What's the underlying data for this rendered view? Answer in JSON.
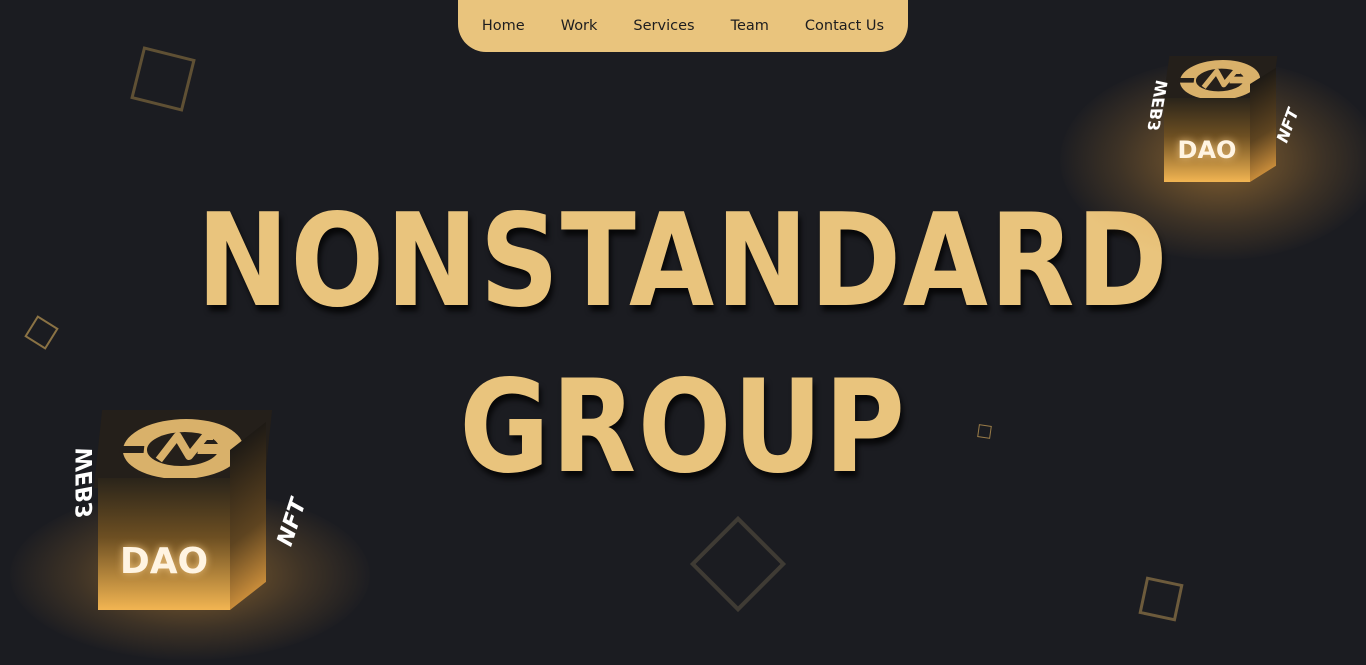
{
  "nav": {
    "items": [
      "Home",
      "Work",
      "Services",
      "Team",
      "Contact Us"
    ]
  },
  "hero": {
    "line1": "NONSTANDARD",
    "line2": "GROUP"
  },
  "cube_left": {
    "front_label": "DAO",
    "left_label": "WEB3",
    "right_label": "NFT",
    "logo": "brand-logo-icon"
  },
  "cube_right": {
    "front_label": "DAO",
    "left_label": "WEB3",
    "right_label": "NFT",
    "logo": "brand-logo-icon"
  },
  "colors": {
    "accent": "#e9c47d",
    "background": "#1b1c21",
    "nav_text": "#1d1d1f"
  }
}
